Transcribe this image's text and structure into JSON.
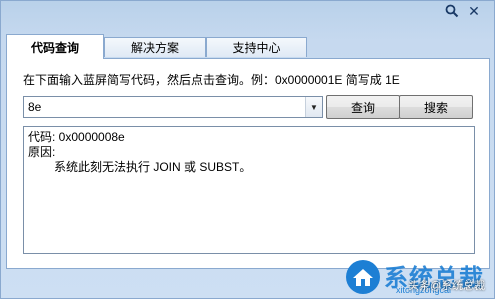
{
  "tabs": [
    {
      "label": "代码查询"
    },
    {
      "label": "解决方案"
    },
    {
      "label": "支持中心"
    }
  ],
  "instruction": "在下面输入蓝屏简写代码，然后点击查询。例：0x0000001E 简写成 1E",
  "code_input": {
    "value": "8e"
  },
  "buttons": {
    "query": "查询",
    "web_search": "搜索"
  },
  "output": {
    "line1": "代码: 0x0000008e",
    "line2": "原因:",
    "line3": "系统此刻无法执行 JOIN 或 SUBST。"
  },
  "watermark": {
    "text": "系统总裁",
    "url": "xitongzongcai",
    "caption": "头条@系统总裁"
  },
  "colors": {
    "accent": "#1d7fd4",
    "frame": "#c6d9ef",
    "border": "#8aa9cf"
  }
}
